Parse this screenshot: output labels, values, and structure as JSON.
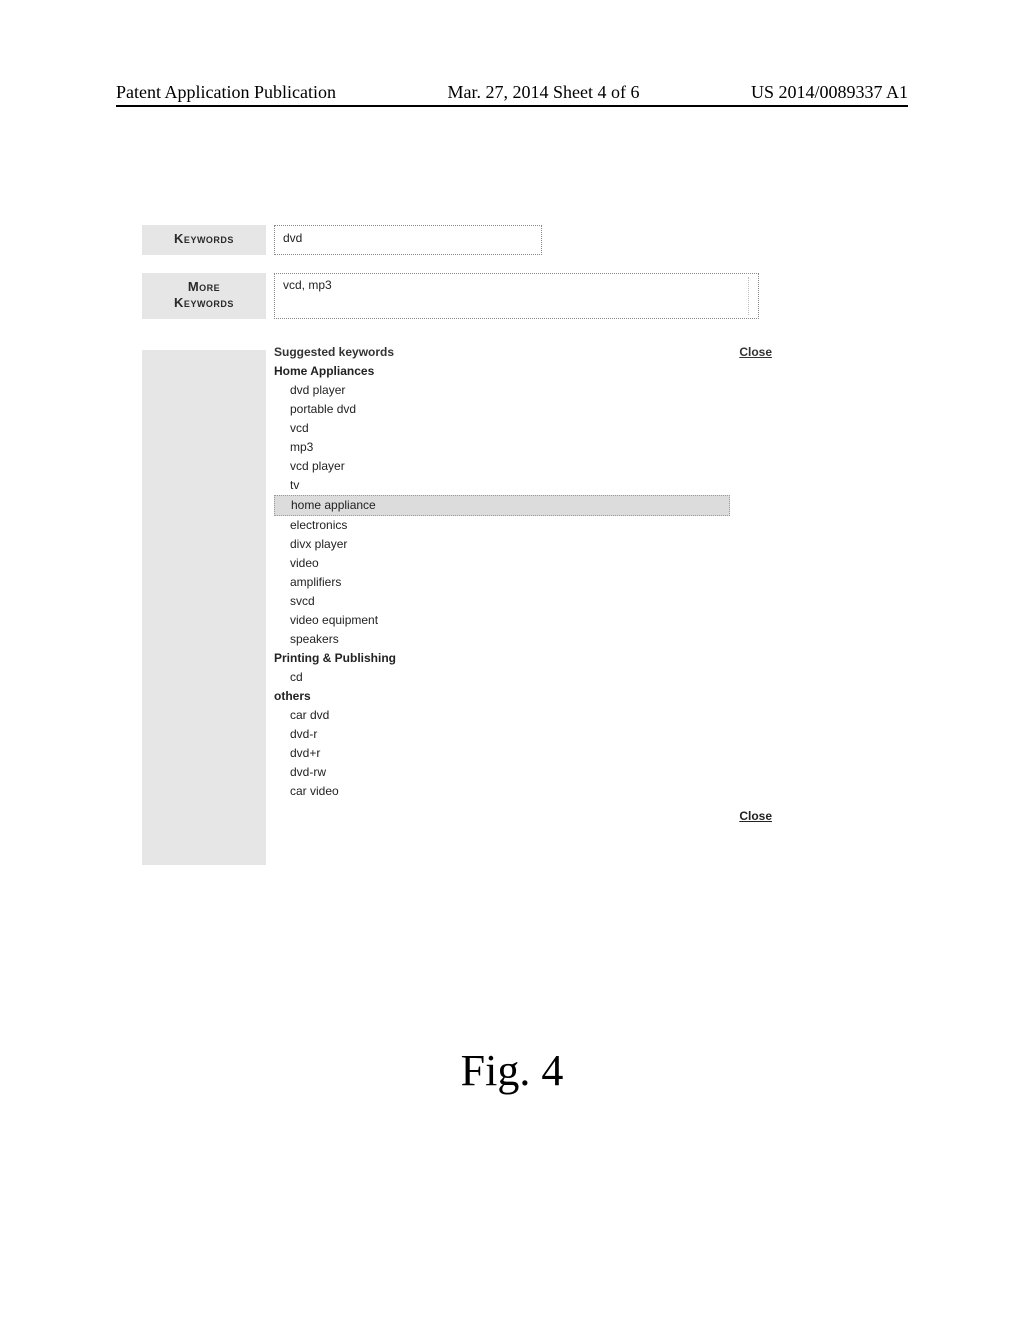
{
  "header": {
    "left": "Patent Application Publication",
    "mid": "Mar. 27, 2014  Sheet 4 of 6",
    "right": "US 2014/0089337 A1"
  },
  "labels": {
    "keywords": "Keywords",
    "more_keywords_line1": "More",
    "more_keywords_line2": "Keywords"
  },
  "inputs": {
    "keywords_value": "dvd",
    "more_keywords_value": "vcd, mp3"
  },
  "suggest": {
    "title": "Suggested keywords",
    "close": "Close",
    "categories": [
      {
        "name": "Home Appliances",
        "items": [
          {
            "t": "dvd player"
          },
          {
            "t": "portable dvd"
          },
          {
            "t": "vcd"
          },
          {
            "t": "mp3"
          },
          {
            "t": "vcd player"
          },
          {
            "t": "tv"
          },
          {
            "t": "home appliance",
            "sel": true
          },
          {
            "t": "electronics"
          },
          {
            "t": "divx player"
          },
          {
            "t": "video"
          },
          {
            "t": "amplifiers"
          },
          {
            "t": "svcd"
          },
          {
            "t": "video equipment"
          },
          {
            "t": "speakers"
          }
        ]
      },
      {
        "name": "Printing & Publishing",
        "items": [
          {
            "t": "cd"
          }
        ]
      },
      {
        "name": "others",
        "items": [
          {
            "t": "car dvd"
          },
          {
            "t": "dvd-r"
          },
          {
            "t": "dvd+r"
          },
          {
            "t": "dvd-rw"
          },
          {
            "t": "car video"
          }
        ]
      }
    ]
  },
  "figure_label": "Fig. 4"
}
